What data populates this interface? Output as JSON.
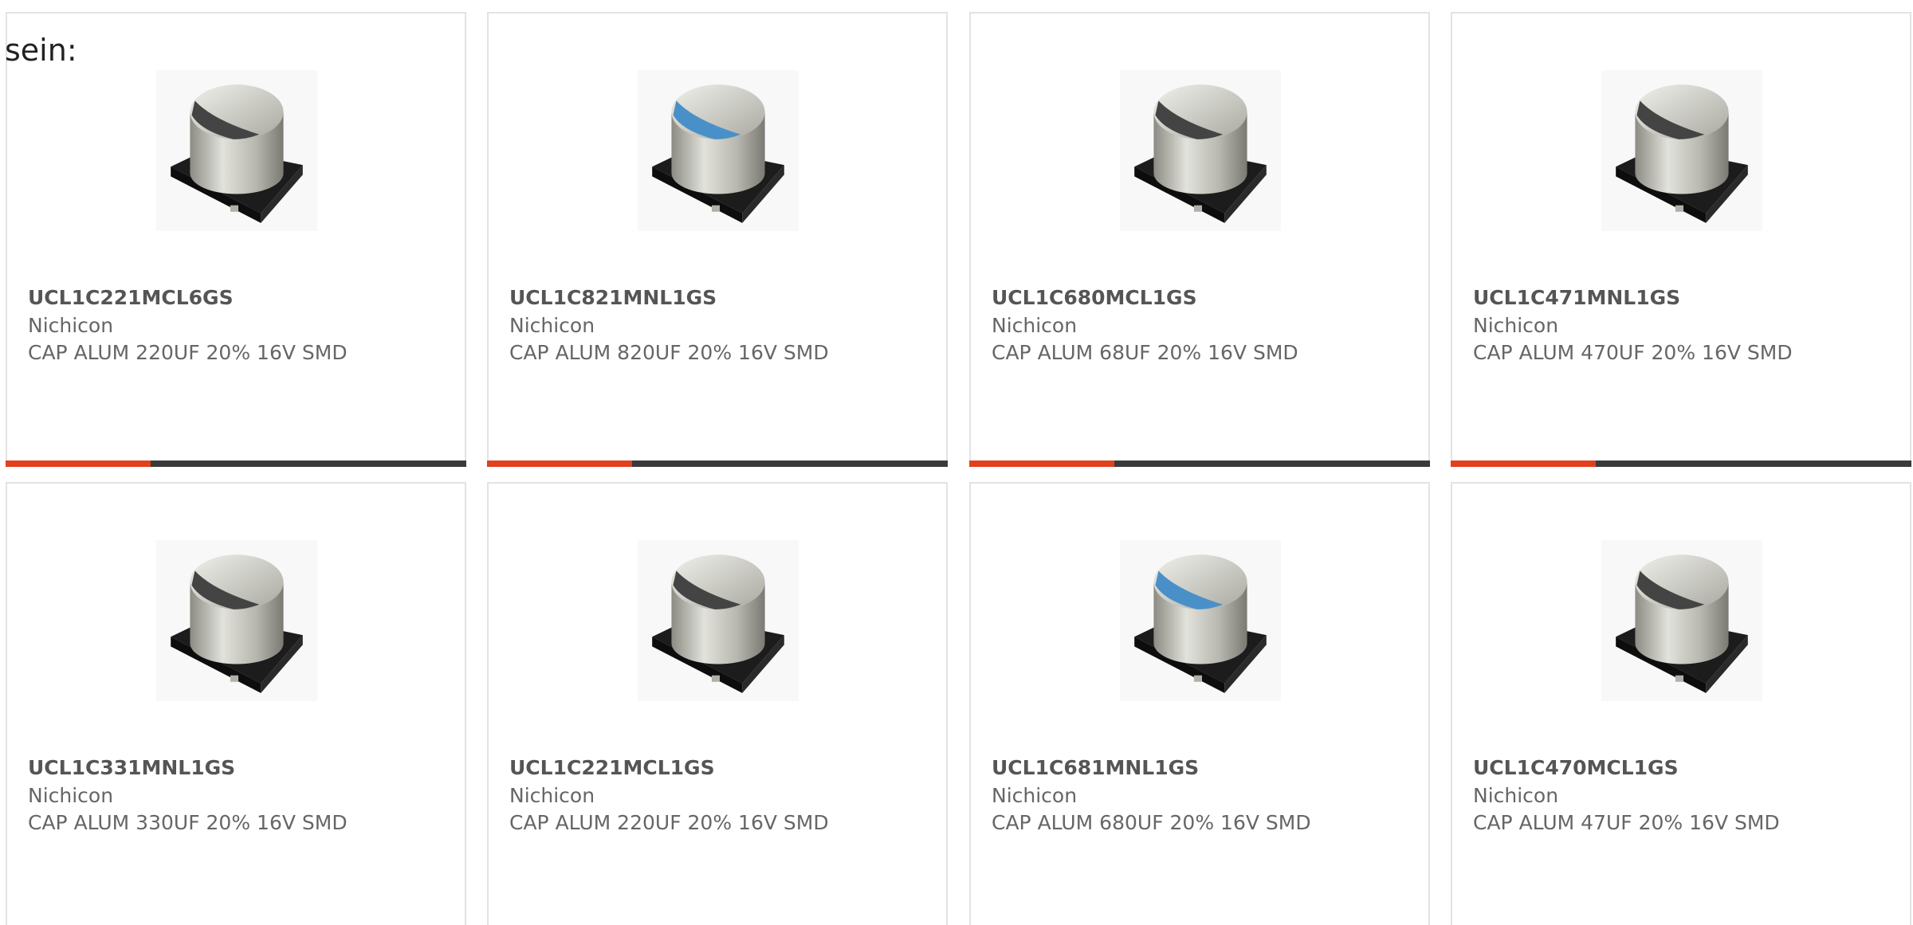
{
  "intro": "sein:",
  "colors": {
    "accent": "#e2401c",
    "bar_track": "#3a3a3a",
    "border": "#e3e3e3",
    "stripe_blue": "#4a90c8",
    "stripe_dark": "#444444"
  },
  "products": [
    {
      "part_number": "UCL1C221MCL6GS",
      "manufacturer": "Nichicon",
      "description": "CAP ALUM 220UF 20% 16V SMD",
      "image_icon": "capacitor-smd-icon",
      "stripe": "dark"
    },
    {
      "part_number": "UCL1C821MNL1GS",
      "manufacturer": "Nichicon",
      "description": "CAP ALUM 820UF 20% 16V SMD",
      "image_icon": "capacitor-smd-icon",
      "stripe": "blue"
    },
    {
      "part_number": "UCL1C680MCL1GS",
      "manufacturer": "Nichicon",
      "description": "CAP ALUM 68UF 20% 16V SMD",
      "image_icon": "capacitor-smd-icon",
      "stripe": "dark"
    },
    {
      "part_number": "UCL1C471MNL1GS",
      "manufacturer": "Nichicon",
      "description": "CAP ALUM 470UF 20% 16V SMD",
      "image_icon": "capacitor-smd-icon",
      "stripe": "dark"
    },
    {
      "part_number": "UCL1C331MNL1GS",
      "manufacturer": "Nichicon",
      "description": "CAP ALUM 330UF 20% 16V SMD",
      "image_icon": "capacitor-smd-icon",
      "stripe": "dark"
    },
    {
      "part_number": "UCL1C221MCL1GS",
      "manufacturer": "Nichicon",
      "description": "CAP ALUM 220UF 20% 16V SMD",
      "image_icon": "capacitor-smd-icon",
      "stripe": "dark"
    },
    {
      "part_number": "UCL1C681MNL1GS",
      "manufacturer": "Nichicon",
      "description": "CAP ALUM 680UF 20% 16V SMD",
      "image_icon": "capacitor-smd-icon",
      "stripe": "blue"
    },
    {
      "part_number": "UCL1C470MCL1GS",
      "manufacturer": "Nichicon",
      "description": "CAP ALUM 47UF 20% 16V SMD",
      "image_icon": "capacitor-smd-icon",
      "stripe": "dark"
    }
  ]
}
